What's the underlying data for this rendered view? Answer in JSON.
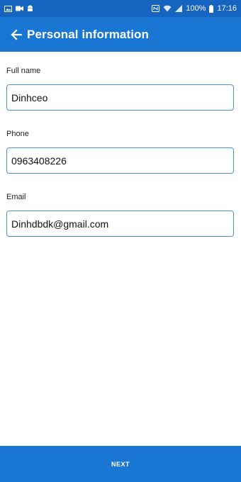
{
  "status_bar": {
    "battery_percent": "100%",
    "time": "17:16",
    "left_icons": [
      "image-icon",
      "video-icon",
      "android-icon"
    ],
    "right_icons": [
      "nfc-icon",
      "wifi-icon",
      "signal-icon",
      "battery-icon"
    ]
  },
  "app_bar": {
    "title": "Personal information",
    "back_icon": "arrow-left-icon"
  },
  "form": {
    "full_name": {
      "label": "Full name",
      "value": "Dinhceo"
    },
    "phone": {
      "label": "Phone",
      "value": "0963408226"
    },
    "email": {
      "label": "Email",
      "value": "Dinhdbdk@gmail.com"
    }
  },
  "footer": {
    "next_label": "NEXT"
  },
  "colors": {
    "status_bar": "#1565c0",
    "primary": "#1976d2",
    "input_border": "#4a90d9"
  }
}
